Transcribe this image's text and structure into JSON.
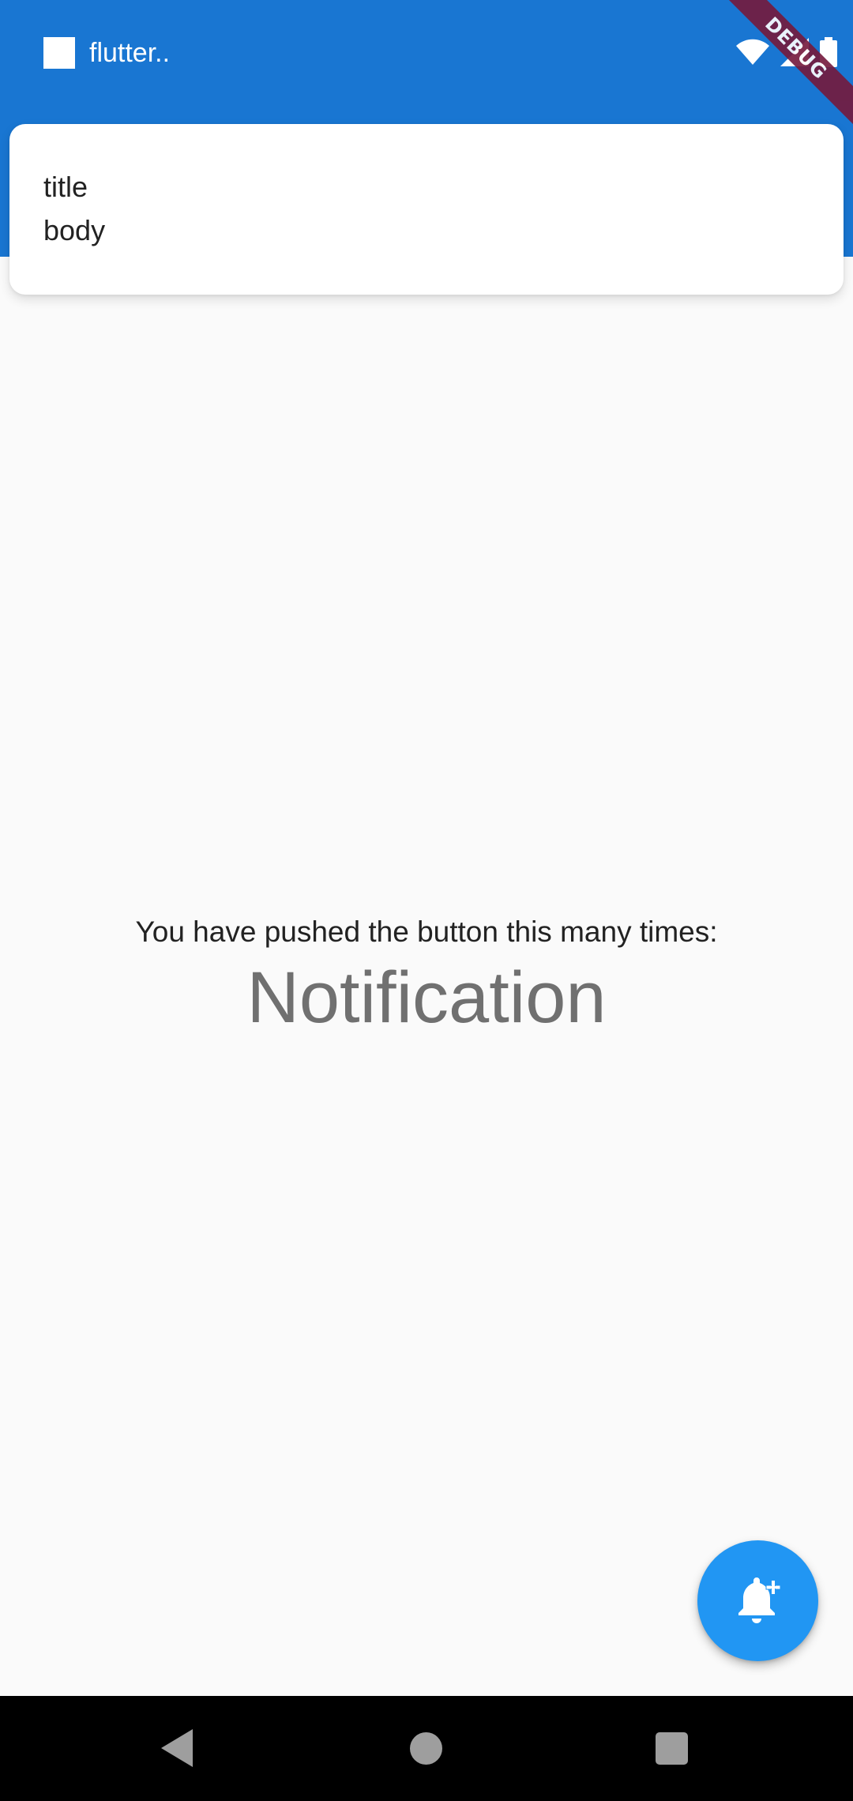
{
  "status_bar": {
    "app_name": "flutter..",
    "icons": [
      "app-notification-icon",
      "wifi-icon",
      "signal-icon",
      "battery-icon"
    ],
    "background_color": "#1976d2"
  },
  "debug_banner": {
    "label": "DEBUG"
  },
  "notification": {
    "title": "title",
    "body": "body"
  },
  "main": {
    "counter_label": "You have pushed the button this many times:",
    "counter_value": "Notification"
  },
  "fab": {
    "icon": "add-alert-icon",
    "color": "#2196f3"
  },
  "nav_bar": {
    "buttons": [
      "back-icon",
      "home-icon",
      "recents-icon"
    ]
  }
}
